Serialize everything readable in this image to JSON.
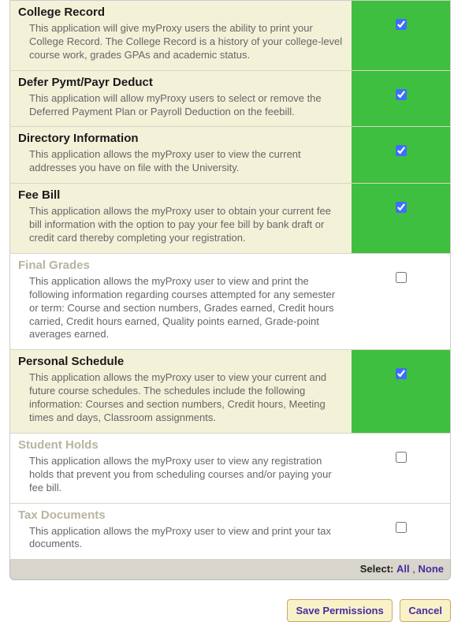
{
  "items": [
    {
      "title": "College Record",
      "desc": "This application will give myProxy users the ability to print your College Record. The College Record is a history of your college-level course work, grades GPAs and academic status.",
      "checked": true
    },
    {
      "title": "Defer Pymt/Payr Deduct",
      "desc": "This application will allow myProxy users to select or remove the Deferred Payment Plan or Payroll Deduction on the feebill.",
      "checked": true
    },
    {
      "title": "Directory Information",
      "desc": "This application allows the myProxy user to view the current addresses you have on file with the University.",
      "checked": true
    },
    {
      "title": "Fee Bill",
      "desc": "This application allows the myProxy user to obtain your current fee bill information with the option to pay your fee bill by bank draft or credit card thereby completing your registration.",
      "checked": true
    },
    {
      "title": "Final Grades",
      "desc": "This application allows the myProxy user to view and print the following information regarding courses attempted for any semester or term: Course and section numbers, Grades earned, Credit hours carried, Credit hours earned, Quality points earned, Grade-point averages earned.",
      "checked": false
    },
    {
      "title": "Personal Schedule",
      "desc": "This application allows the myProxy user to view your current and future course schedules. The schedules include the following information: Courses and section numbers, Credit hours, Meeting times and days, Classroom assignments.",
      "checked": true
    },
    {
      "title": "Student Holds",
      "desc": "This application allows the myProxy user to view any registration holds that prevent you from scheduling courses and/or paying your fee bill.",
      "checked": false
    },
    {
      "title": "Tax Documents",
      "desc": "This application allows the myProxy user to view and print your tax documents.",
      "checked": false
    }
  ],
  "select": {
    "label": "Select:",
    "all": "All",
    "sep": ",",
    "none": "None"
  },
  "buttons": {
    "save": "Save Permissions",
    "cancel": "Cancel"
  }
}
